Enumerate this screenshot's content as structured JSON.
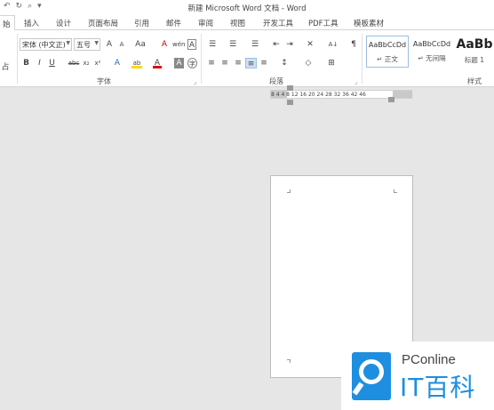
{
  "window": {
    "title": "新建 Microsoft Word 文档 - Word"
  },
  "quick_access": {
    "undo": "↶",
    "redo": "↻",
    "preview": "⌕",
    "more": "▾"
  },
  "tabs": [
    "始",
    "插入",
    "设计",
    "页面布局",
    "引用",
    "邮件",
    "审阅",
    "视图",
    "开发工具",
    "PDF工具",
    "模板素材"
  ],
  "clipboard": {
    "partial_label": "占"
  },
  "font": {
    "font_name": "宋体 (中文正)",
    "font_size": "五号",
    "group_label": "字体",
    "buttons": [
      "A",
      "A",
      "Aa",
      "A",
      "wén",
      "A",
      "B",
      "I",
      "U",
      "abc",
      "x₂",
      "x²",
      "A",
      "ab",
      "A",
      "A",
      "字"
    ]
  },
  "paragraph": {
    "group_label": "段落",
    "row1": [
      "☰",
      "☰",
      "☰",
      "⇤",
      "⇥",
      "✕",
      "A↓",
      "¶"
    ],
    "row2": [
      "≡",
      "≡",
      "≡",
      "≡",
      "≡",
      "↕",
      "◇",
      "⊞"
    ]
  },
  "styles": {
    "group_label": "样式",
    "items": [
      {
        "sample": "AaBbCcDd",
        "name": "↵ 正文"
      },
      {
        "sample": "AaBbCcDd",
        "name": "↵ 无间隔"
      },
      {
        "sample": "AaBb",
        "name": "标题 1"
      }
    ]
  },
  "ruler": {
    "numbers": "8  4      4   8  12 16  20  24  28  32  36     42  46"
  },
  "watermark": {
    "brand": "PConline",
    "name": "IT百科"
  }
}
